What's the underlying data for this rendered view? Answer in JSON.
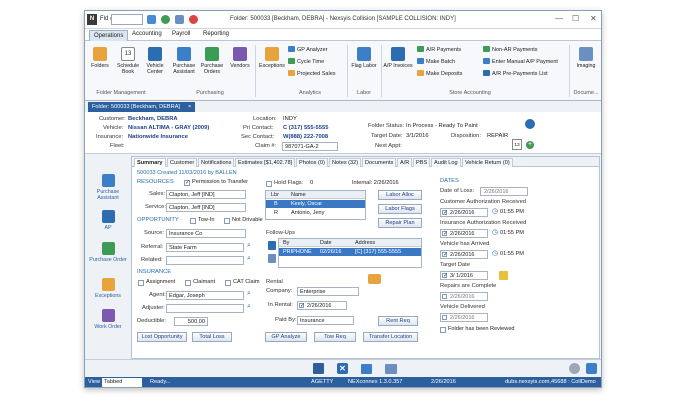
{
  "titlebar": {
    "logo": "N",
    "fld_label": "Fld #",
    "fld_value": "",
    "title": "Folder: 500033 [Beckham, DEBRA] - Nexsyis Collision [SAMPLE COLLISION: INDY]",
    "ctrl_min": "—",
    "ctrl_max": "☐",
    "ctrl_close": "✕"
  },
  "menu": {
    "operations": "Operations",
    "accounting": "Accounting",
    "payroll": "Payroll",
    "reporting": "Reporting"
  },
  "ribbon": {
    "folders": "Folders",
    "schedule_book": "Schedule Book",
    "vehicle_center": "Vehicle Center",
    "purchase_assistant": "Purchase Assistant",
    "purchase_orders": "Purchase Orders",
    "vendors": "Vendors",
    "folder_mgmt": "Folder Management",
    "purchasing": "Purchasing",
    "schedule_date": "13",
    "exceptions": "Exceptions",
    "gp_analyzer": "GP Analyzer",
    "cycle_time": "Cycle Time",
    "projected_sales": "Projected Sales",
    "analytics": "Analytics",
    "flag_labor": "Flag Labor",
    "labor": "Labor",
    "ap_invoices": "A/P Invoices",
    "ar_payments": "A/R Payments",
    "make_batch": "Make Batch",
    "make_deposits": "Make Deposits",
    "non_ar_payments": "Non-AR Payments",
    "manual_ap": "Enter Manual A/P Payment",
    "ar_prepayments": "A/R Pre-Payments List",
    "store_accounting": "Store Accounting",
    "imaging": "Imaging",
    "docume": "Docume..."
  },
  "doc_tab": {
    "label": "Folder: 500033 [Beckham, DEBRA]",
    "close": "×"
  },
  "info": {
    "customer_label": "Customer:",
    "customer": "Beckham, DEBRA",
    "vehicle_label": "Vehicle:",
    "vehicle": "Nissan ALTIMA - GRAY (2009)",
    "insurance_label": "Insurance:",
    "insurance": "Nationwide Insurance",
    "fleet_label": "Fleet:",
    "fleet": "",
    "location_label": "Location:",
    "location": "INDY",
    "pri_contact_label": "Pri Contact:",
    "pri_contact": "C (317) 555-5555",
    "sec_contact_label": "Sec Contact:",
    "sec_contact": "W(888) 222-7008",
    "claim_label": "Claim #:",
    "claim": "987071-GA-2",
    "folder_status_label": "Folder Status:",
    "folder_status": "In Process - Ready To Paint",
    "target_date_label": "Target Date:",
    "target_date": "3/1/2016",
    "disposition_label": "Disposition:",
    "disposition": "REPAIR",
    "next_appt_label": "Next Appt:",
    "next_appt": "",
    "cal_num": "13"
  },
  "sidebar": {
    "purchase_assistant": "Purchase Assistant",
    "ap": "AP",
    "purchase_order": "Purchase Order",
    "exceptions": "Exceptions",
    "work_order": "Work Order"
  },
  "tabs": [
    "Summary",
    "Customer",
    "Notifications",
    "Estimates [$1,402.78]",
    "Photos (0)",
    "Notes (32)",
    "Documents",
    "A/R",
    "PBS",
    "Audit Log",
    "Vehicle Return (0)"
  ],
  "summary": {
    "created": "500033 Created 11/03/2016 by BALLEN",
    "resources": "RESOURCES",
    "permission": "Permission to Transfer",
    "sales_label": "Sales:",
    "sales": "Clapton, Jeff [IND]",
    "service_label": "Service:",
    "service": "Clapton, Jeff [IND]",
    "opportunity": "OPPORTUNITY",
    "tow_in": "Tow-In",
    "not_drivable": "Not Drivable",
    "source_label": "Source:",
    "source": "Insurance Co",
    "referral_label": "Referral:",
    "referral": "State Farm",
    "related_label": "Related:",
    "related": "",
    "insurance_sec": "INSURANCE",
    "assignment": "Assignment",
    "claimant": "Claimant",
    "cat_claim": "CAT Claim",
    "agent_label": "Agent:",
    "agent": "Edgar, Joseph",
    "adjuster_label": "Adjuster:",
    "adjuster": "",
    "deductible_label": "Deductible:",
    "deductible": "500.00",
    "lost_opportunity": "Lost Opportunity",
    "total_loss": "Total Loss",
    "hold_flags_label": "Hold Flags:",
    "hold_flags_count": "0",
    "internal": "Internal: 2/26/2016",
    "labor_col": "Lbr",
    "name_col": "Name",
    "labor_rows": [
      {
        "lbr": "B",
        "name": "Keely, Oscar"
      },
      {
        "lbr": "R",
        "name": "Antonio, Jeny"
      }
    ],
    "labor_alloc": "Labor Alloc",
    "labor_flags": "Labor Flags",
    "repair_plan": "Repair Plan",
    "followups": "Follow-Ups",
    "fu_by": "By",
    "fu_date": "Date",
    "fu_address": "Address",
    "fu_row": {
      "by": "PRIPHONE",
      "date": "02/26/16",
      "address": "[C] (317) 555-5555"
    },
    "rental": "Rental",
    "company_label": "Company:",
    "company": "Enterprise",
    "in_rental_label": "In Rental:",
    "in_rental": "2/26/2016",
    "paid_by_label": "Paid By:",
    "paid_by": "Insurance",
    "rent_req": "Rent Req",
    "gp_analyze": "GP Analyze",
    "tow_req": "Tow Req",
    "transfer_location": "Transfer Location",
    "dates": "DATES",
    "date_of_loss_label": "Date of Loss:",
    "date_of_loss": "2/26/2016",
    "cust_auth_label": "Customer Authorization Received",
    "cust_auth": "2/26/2016",
    "cust_auth_time": "01:55 PM",
    "ins_auth_label": "Insurance Authorization Received",
    "ins_auth": "2/26/2016",
    "ins_auth_time": "01:55 PM",
    "vehicle_arrived_label": "Vehicle has Arrived",
    "vehicle_arrived": "2/26/2016",
    "vehicle_arrived_time": "01:55 PM",
    "target_label": "Target Date",
    "target": "3/ 1/2016",
    "repairs_complete_label": "Repairs are Complete",
    "repairs_complete": "2/26/2016",
    "vehicle_delivered_label": "Vehicle Delivered",
    "vehicle_delivered": "2/26/2016",
    "folder_reviewed": "Folder has been Reviewed"
  },
  "status": {
    "view_label": "View",
    "view_value": "Tabbed",
    "ready": "Ready...",
    "user": "AGETTY",
    "version": "NEXconnex 1.3.0.357",
    "date": "2/26/2016",
    "server": "dubs.nexsyis.com,45688 : CollDemo"
  },
  "colors": {
    "accent": "#2b5f9e",
    "selected": "#3b78c4",
    "label_blue": "#2b6db0"
  }
}
